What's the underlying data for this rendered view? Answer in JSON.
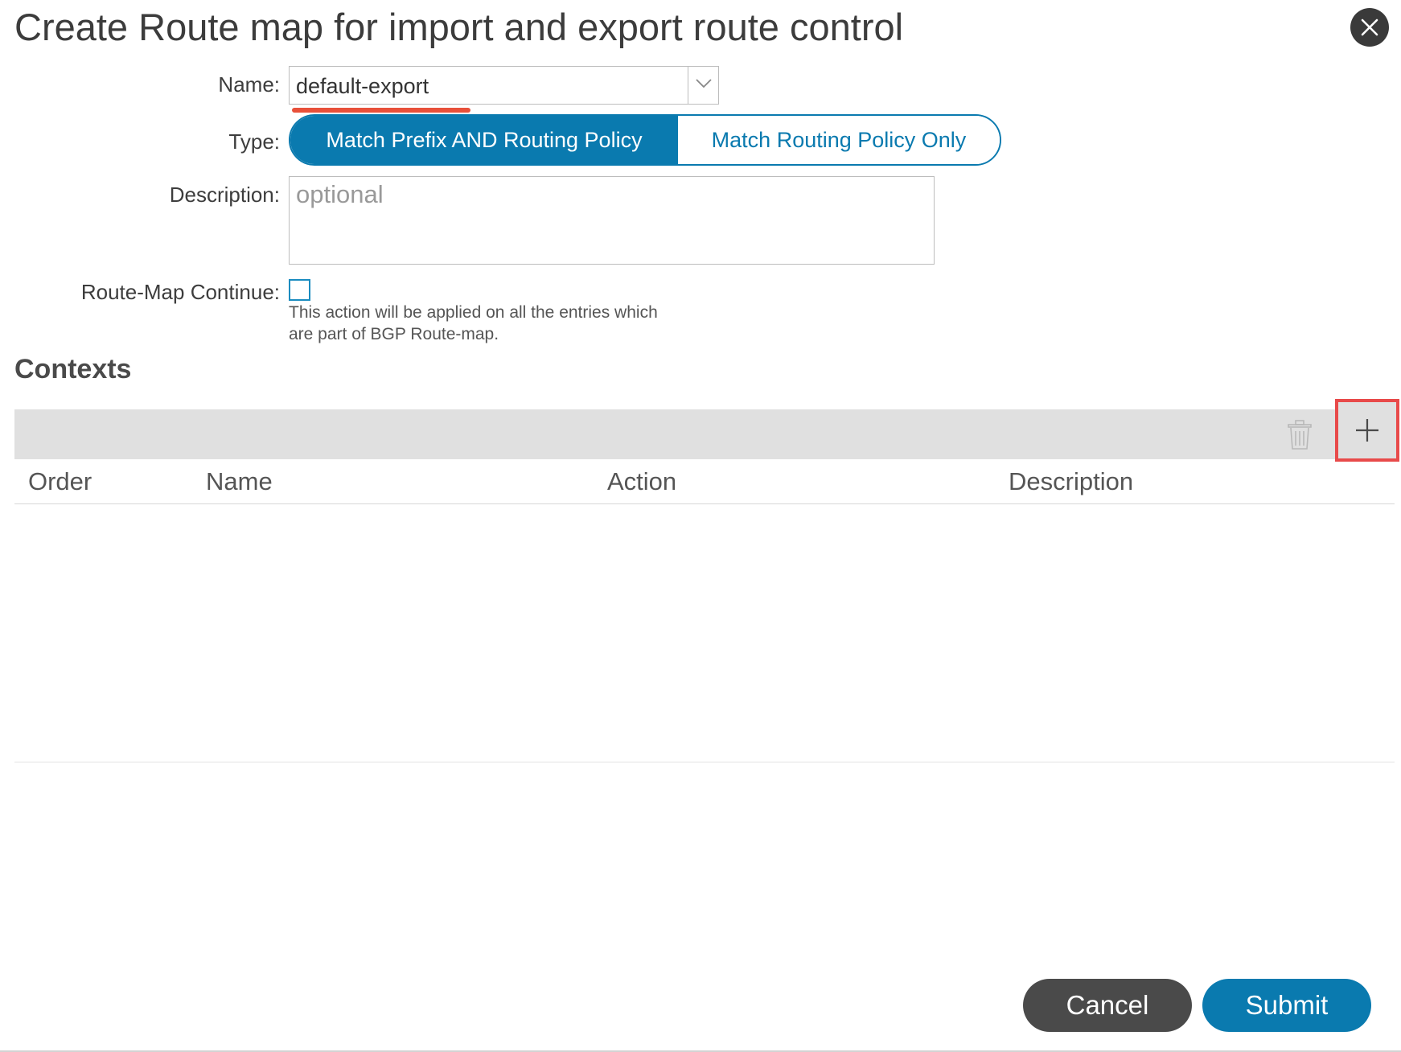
{
  "dialog": {
    "title": "Create Route map for import and export route control"
  },
  "form": {
    "name_label": "Name:",
    "name_value": "default-export",
    "type_label": "Type:",
    "type_options": [
      {
        "label": "Match Prefix AND Routing Policy",
        "selected": true
      },
      {
        "label": "Match Routing Policy Only",
        "selected": false
      }
    ],
    "description_label": "Description:",
    "description_placeholder": "optional",
    "continue_label": "Route-Map Continue:",
    "continue_checked": false,
    "continue_help_line1": "This action will be applied on all the entries which",
    "continue_help_line2": "are part of BGP Route-map."
  },
  "contexts": {
    "title": "Contexts",
    "columns": [
      "Order",
      "Name",
      "Action",
      "Description"
    ],
    "rows": []
  },
  "footer": {
    "cancel_label": "Cancel",
    "submit_label": "Submit"
  },
  "colors": {
    "accent": "#0a7aaf",
    "highlight": "#e84a4a",
    "cancel_bg": "#4a4a4a"
  }
}
